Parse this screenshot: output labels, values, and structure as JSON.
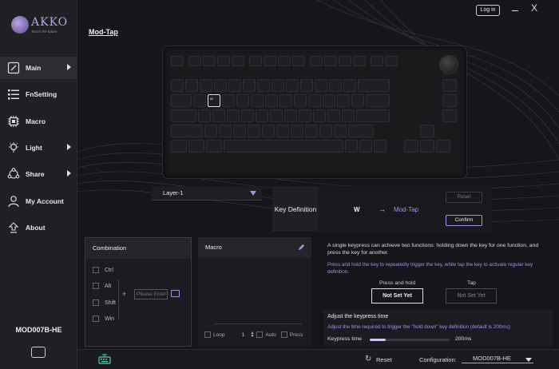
{
  "app": {
    "logo_name": "AKKO",
    "logo_tagline": "Touch the future",
    "login_label": "Log in",
    "close_label": "X"
  },
  "sidebar": {
    "items": [
      {
        "label": "Main",
        "icon": "edit-icon",
        "active": true,
        "arrow": true
      },
      {
        "label": "FnSetting",
        "icon": "list-icon",
        "active": false,
        "arrow": false
      },
      {
        "label": "Macro",
        "icon": "chip-icon",
        "active": false,
        "arrow": false
      },
      {
        "label": "Light",
        "icon": "bulb-icon",
        "active": false,
        "arrow": true
      },
      {
        "label": "Share",
        "icon": "share-icon",
        "active": false,
        "arrow": true
      },
      {
        "label": "My Account",
        "icon": "user-icon",
        "active": false,
        "arrow": false
      },
      {
        "label": "About",
        "icon": "upload-icon",
        "active": false,
        "arrow": false
      }
    ],
    "device_name": "MOD007B-HE"
  },
  "main": {
    "page_title": "Mod-Tap",
    "selected_key": "W"
  },
  "layer": {
    "selected": "Layer-1"
  },
  "key_definition": {
    "label": "Key Definition",
    "key": "W",
    "arrow": "→",
    "value": "Mod-Tap",
    "reset_label": "Reset",
    "confirm_label": "Confirm"
  },
  "combination": {
    "title": "Combination",
    "modifiers": [
      "Ctrl",
      "Alt",
      "Shift",
      "Win"
    ],
    "plus": "+",
    "input_placeholder": "Please Enter"
  },
  "macro": {
    "title": "Macro",
    "loop_label": "Loop",
    "loop_count": "1",
    "auto_label": "Auto",
    "press_label": "Press"
  },
  "info": {
    "description": "A single keypress can achieve two functions: holding down the key for one function, and press the key for another.",
    "note": "Press and hold the key to repeatedly trigger the key, while tap the key to activate regular key definition.",
    "hold_label": "Press and hold",
    "hold_value": "Not Set Yet",
    "tap_label": "Tap",
    "tap_value": "Not Set Yet",
    "keypress_title": "Adjust the keypress time",
    "keypress_note": "Adjust the time required to trigger the \"hold down\" key definition (default is 200ms)",
    "keypress_label": "Keypress time",
    "keypress_value": "200ms",
    "keypress_fraction": 0.2
  },
  "bottom": {
    "reset_label": "Reset",
    "config_label": "Configuration:",
    "config_value": "MOD007B-HE"
  },
  "colors": {
    "accent": "#a98ee8",
    "background": "#15161a",
    "sidebar": "#1f2024"
  }
}
